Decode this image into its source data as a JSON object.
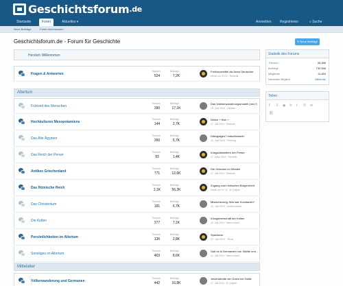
{
  "header": {
    "logo_text": "Geschichtsforum",
    "logo_tld": ".de"
  },
  "navbar": {
    "tabs": [
      "Startseite",
      "Foren",
      "Aktuelles ▾"
    ],
    "right": [
      "Anmelden",
      "Registrieren",
      "Suche"
    ]
  },
  "subnav": [
    "Neue Beiträge",
    "Foren durchsuchen"
  ],
  "page": {
    "title": "Geschichtsforum.de - Forum für Geschichte",
    "new_post_button": "Neue Beiträge"
  },
  "welcome": "Herzlich Willkommen",
  "stat_labels": {
    "threads": "Themen",
    "posts": "Beiträge"
  },
  "qa_row": {
    "title": "Fragen & Antworten",
    "threads": "524",
    "posts": "7,2K",
    "last_title": "Freikorpsmittel als Ausw Deutscher",
    "last_meta": "Heute um 03:11 · Ravenik"
  },
  "categories": [
    {
      "name": "Altertum",
      "forums": [
        {
          "title": "Frühzeit des Menschen",
          "threads": "390",
          "posts": "17,1K",
          "last_title": "Das Voelkerwanderungsmodell (neu?)",
          "last_meta": "29. Juni 2024 · Dekebe"
        },
        {
          "title": "Hochkulturen Mesopotamiens",
          "threads": "144",
          "posts": "2,7K",
          "last_title": "Ninive + Kish +",
          "last_meta": "17. Juli 2024 · Ravenik"
        },
        {
          "title": "Das Alte Ägypten",
          "threads": "260",
          "posts": "5,7K",
          "last_title": "Dilengalgen? entschlüsseln",
          "last_meta": "12. Juni 2024 · Pleming"
        },
        {
          "title": "Das Reich der Perser",
          "threads": "93",
          "posts": "1,4K",
          "last_title": "Kriegsdarstellern der Perser",
          "last_meta": "17. März 2024 · Ravenik"
        },
        {
          "title": "Antikes Griechenland",
          "threads": "771",
          "posts": "12,6K",
          "last_title": "Die Griechen im Westen",
          "last_meta": "17. Juli 2024 · Ravenik"
        },
        {
          "title": "Das Römische Reich",
          "threads": "2,1K",
          "posts": "56,2K",
          "last_title": "Zugang zum römischen Bürgerrecht",
          "last_meta": "Heute um 07:11 · El Quijote"
        },
        {
          "title": "Das Christentum",
          "threads": "181",
          "posts": "6,7K",
          "last_title": "Missionierung: Wer war Konstantin?",
          "last_meta": "24. Juni 2024 · andersnaecht"
        },
        {
          "title": "Die Kelten",
          "threads": "277",
          "posts": "7,1K",
          "last_title": "Königsherrschaft der Kelten",
          "last_meta": "22. Juli 2024 · Nemo minor"
        },
        {
          "title": "Persönlichkeiten im Altertum",
          "threads": "136",
          "posts": "2,8K",
          "last_title": "Spartacus",
          "last_meta": "22. Juni 2024 · Tehra"
        },
        {
          "title": "Sonstiges im Altertum",
          "threads": "403",
          "posts": "8,6K",
          "last_title": "Galt es in Germanien von Städte und...",
          "last_meta": "01. Juli 2024 · Nemo minor"
        }
      ]
    },
    {
      "name": "Mittelalter",
      "forums": [
        {
          "title": "Völkerwanderung und Germanen",
          "threads": "442",
          "posts": "16,8K",
          "last_title": "Jetzendtrotte der Goten bei Tarifa",
          "last_meta": "17. Juli 2024 · El Quijote"
        }
      ]
    }
  ],
  "sidebar": {
    "stats_title": "Statistik des Forums",
    "stats": [
      {
        "label": "Themen",
        "value": "35.466"
      },
      {
        "label": "Beiträge",
        "value": "732.546"
      },
      {
        "label": "Mitglieder",
        "value": "11.454"
      },
      {
        "label": "Neuestes Mitglied",
        "value": "Millelotte"
      }
    ],
    "share_title": "Teilen",
    "share_icons": [
      "facebook-icon",
      "x-icon",
      "reddit-icon",
      "pinterest-icon",
      "tumblr-icon",
      "whatsapp-icon",
      "email-icon",
      "link-icon"
    ]
  },
  "colors": {
    "header": "#185886",
    "accent": "#2577b1",
    "button": "#47a7eb",
    "category_bg": "#dfe8f0"
  }
}
